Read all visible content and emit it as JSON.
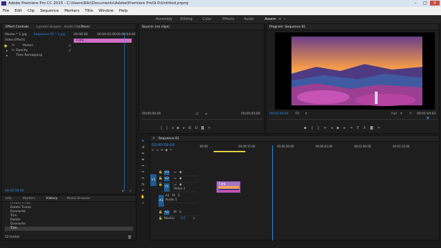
{
  "window": {
    "title": "Adobe Premiere Pro CC 2015 - C:\\Users\\Riki\\Documents\\Adobe\\Premiere Pro\\9.0\\Untitled.prproj"
  },
  "menu": [
    "File",
    "Edit",
    "Clip",
    "Sequence",
    "Markers",
    "Title",
    "Window",
    "Help"
  ],
  "workspaces": [
    "Assembly",
    "Editing",
    "Color",
    "Effects",
    "Audio",
    "Assem"
  ],
  "effect_controls": {
    "tabs": [
      "Effect Controls",
      "Lumetri Scopes",
      "Audio Clip Mixer",
      "Effects"
    ],
    "master_label": "Master * 1.jpg",
    "sequence_label": "Sequence 01 * 1.jpg",
    "ruler_start": "00:00:00",
    "ruler_mid": "00:00:02:00",
    "ruler_end": "00:00:04:00",
    "clip_label": "1.jpg",
    "section": "Video Effects",
    "effects": [
      "Motion",
      "Opacity",
      "Time Remapping"
    ],
    "fx_badge": "fx",
    "timecode": "00:00:59:04"
  },
  "history": {
    "tabs": [
      "Info",
      "Markers",
      "History",
      "Media Browser"
    ],
    "items": [
      "Create a Clip",
      "Delete Tracks",
      "Overwrite",
      "Trim",
      "Delete",
      "Overwrite",
      "Trim"
    ],
    "footer": "22 Undos"
  },
  "source": {
    "tab": "Source: (no clips)",
    "tc_left": "00;00;00;00",
    "tc_right": "00;00;00;00"
  },
  "program": {
    "tab": "Program: Sequence 01",
    "tc_left": "00:00:59:04",
    "fit": "Fit",
    "quality": "Full",
    "tc_right": "00:01:04:03"
  },
  "timeline": {
    "tab": "Sequence 01",
    "timecode": "00:00:59:04",
    "ruler": [
      "00:00",
      "00:00:15:00",
      "00:00:30:00",
      "00:00:45:00",
      "00:01:00:00",
      "00:01:15:00"
    ],
    "video_tracks": [
      {
        "id": "V3",
        "name": ""
      },
      {
        "id": "V2",
        "name": ""
      },
      {
        "id": "V1",
        "name": "Video 1"
      }
    ],
    "audio_tracks": [
      {
        "id": "A1",
        "name": "Audio 1"
      },
      {
        "id": "A2",
        "name": ""
      }
    ],
    "master": {
      "label": "Master",
      "value": "0.0"
    },
    "src_v": "V1",
    "src_a": "A1",
    "clip_name": "1.jpg",
    "playhead_fraction": 0.305
  },
  "colors": {
    "accent": "#2d8ceb",
    "clip_pink": "#d06ec4",
    "track_blue": "#1f5b8f"
  }
}
